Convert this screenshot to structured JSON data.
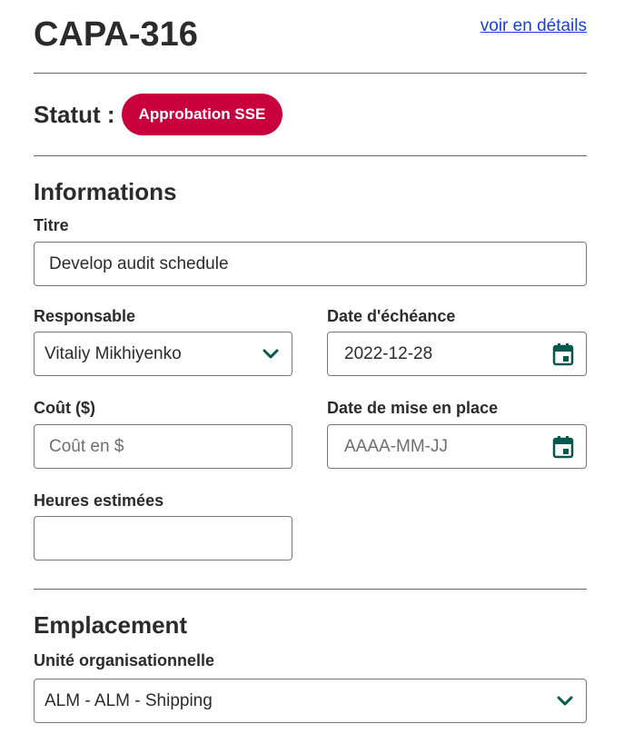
{
  "header": {
    "title": "CAPA-316",
    "details_link": "voir en détails"
  },
  "status": {
    "label": "Statut :",
    "value": "Approbation SSE",
    "color": "#c8003e"
  },
  "informations": {
    "title": "Informations",
    "titre": {
      "label": "Titre",
      "value": "Develop audit schedule"
    },
    "responsable": {
      "label": "Responsable",
      "value": "Vitaliy Mikhiyenko",
      "icon": "chevron-down-icon"
    },
    "date_echeance": {
      "label": "Date d'échéance",
      "value": "2022-12-28",
      "icon": "calendar-icon"
    },
    "cout": {
      "label": "Coût ($)",
      "placeholder": "Coût en $",
      "value": ""
    },
    "date_mise_en_place": {
      "label": "Date de mise en place",
      "placeholder": "AAAA-MM-JJ",
      "value": "",
      "icon": "calendar-icon"
    },
    "heures_estimees": {
      "label": "Heures estimées",
      "value": ""
    }
  },
  "emplacement": {
    "title": "Emplacement",
    "unite": {
      "label": "Unité organisationnelle",
      "value": "ALM - ALM - Shipping",
      "icon": "chevron-down-icon"
    }
  },
  "colors": {
    "accent": "#00594c",
    "link": "#1a3fd6",
    "text": "#2b2b2b",
    "border": "#777777"
  }
}
